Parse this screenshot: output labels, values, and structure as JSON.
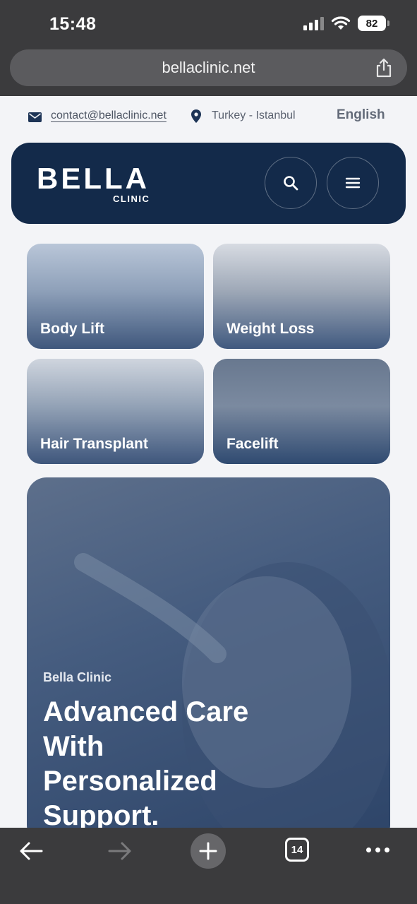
{
  "status_bar": {
    "time": "15:48",
    "battery": "82",
    "icons": [
      "signal-icon",
      "wifi-icon",
      "battery-icon"
    ]
  },
  "browser": {
    "url": "bellaclinic.net",
    "tabs_count": "14",
    "icons": [
      "share-icon",
      "back-arrow-icon",
      "forward-arrow-icon",
      "plus-icon",
      "tabs-icon",
      "more-icon"
    ]
  },
  "contact": {
    "email": "contact@bellaclinic.net",
    "location": "Turkey - Istanbul",
    "language": "English"
  },
  "header": {
    "logo_main": "BELLA",
    "logo_sub": "CLINIC",
    "icons": [
      "search-icon",
      "menu-icon"
    ]
  },
  "services": [
    {
      "label": "Body Lift"
    },
    {
      "label": "Weight Loss"
    },
    {
      "label": "Hair Transplant"
    },
    {
      "label": "Facelift"
    }
  ],
  "hero": {
    "eyebrow": "Bella Clinic",
    "title": "Advanced Care With Personalized Support."
  },
  "colors": {
    "brand_navy": "#132a4a",
    "page_bg": "#f3f4f7",
    "browser_chrome": "#3b3b3d"
  }
}
